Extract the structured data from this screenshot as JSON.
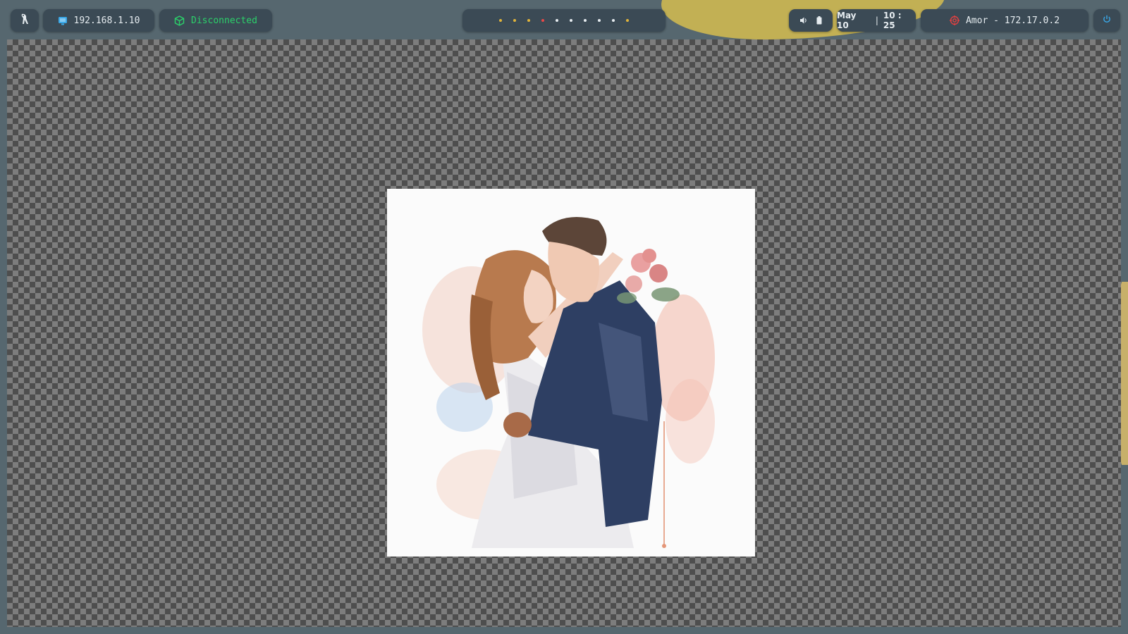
{
  "topbar": {
    "launcher_icon": "penguin-icon",
    "ip": {
      "icon": "monitor-icon",
      "text": "192.168.1.10",
      "color": "#3aa8e8"
    },
    "vpn": {
      "icon": "cube-icon",
      "text": "Disconnected",
      "color": "#2bd16a"
    },
    "workspaces": {
      "dots": [
        {
          "color": "#e0b43a"
        },
        {
          "color": "#e0b43a"
        },
        {
          "color": "#e0b43a"
        },
        {
          "color": "#e84848"
        },
        {
          "color": "#e6ecf0"
        },
        {
          "color": "#e6ecf0"
        },
        {
          "color": "#e6ecf0"
        },
        {
          "color": "#e6ecf0"
        },
        {
          "color": "#e6ecf0"
        },
        {
          "color": "#e0b43a"
        }
      ]
    },
    "system": {
      "volume_icon": "volume-icon",
      "battery_icon": "battery-icon"
    },
    "clock": {
      "date": "May 10",
      "separator": "|",
      "time": "10 : 25"
    },
    "target": {
      "icon": "target-icon",
      "text": "Amor - 172.17.0.2",
      "color": "#e04040"
    },
    "power_icon": "power-icon"
  },
  "viewer": {
    "image_subject": "watercolor-wedding-couple"
  }
}
